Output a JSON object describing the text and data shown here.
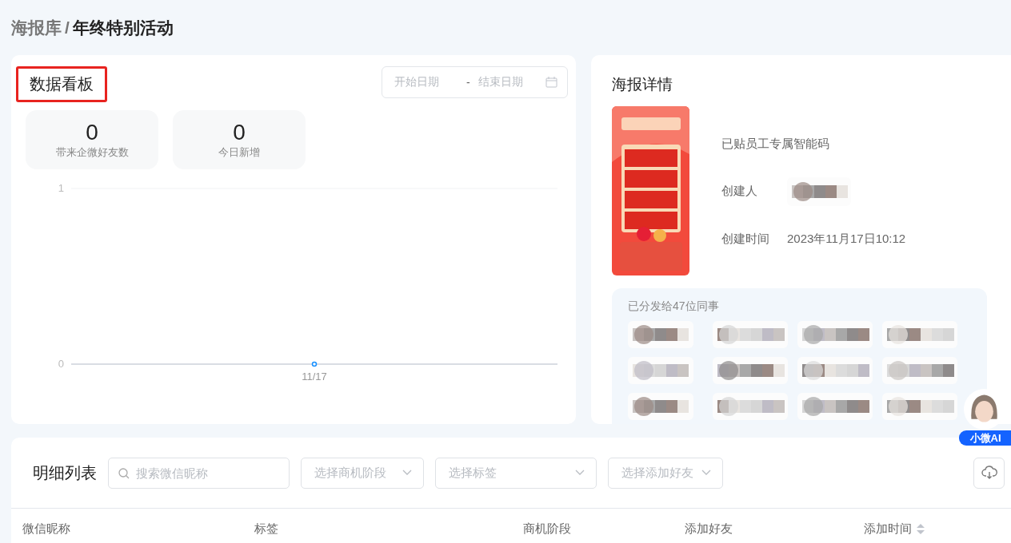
{
  "breadcrumb": {
    "parent": "海报库",
    "separator": "/",
    "current": "年终特别活动"
  },
  "dashboard": {
    "title": "数据看板",
    "highlighted": true,
    "date_range": {
      "start_placeholder": "开始日期",
      "separator": "-",
      "end_placeholder": "结束日期"
    },
    "stats": [
      {
        "value": "0",
        "label": "带来企微好友数"
      },
      {
        "value": "0",
        "label": "今日新增"
      }
    ],
    "chart_data": {
      "type": "line",
      "categories": [
        "11/17"
      ],
      "series": [
        {
          "color": "#1890ff",
          "marker": true,
          "values": [
            0
          ]
        }
      ],
      "ylim": [
        0,
        1
      ],
      "yticks": [
        0,
        1
      ]
    }
  },
  "poster_detail": {
    "title": "海报详情",
    "status": "已贴员工专属智能码",
    "fields": [
      {
        "label": "创建人",
        "kind": "picture"
      },
      {
        "label": "创建时间",
        "kind": "text",
        "value": "2023年11月17日10:12"
      }
    ],
    "distribution": {
      "title": "已分发给47位同事"
    }
  },
  "assistant": {
    "label": "小微AI"
  },
  "detail_list": {
    "title": "明细列表",
    "search": {
      "placeholder": "搜索微信昵称"
    },
    "filters": [
      {
        "placeholder": "选择商机阶段"
      },
      {
        "placeholder": "选择标签"
      },
      {
        "placeholder": "选择添加好友"
      }
    ],
    "columns": [
      {
        "label": "微信昵称",
        "sortable": false
      },
      {
        "label": "标签",
        "sortable": false
      },
      {
        "label": "商机阶段",
        "sortable": false
      },
      {
        "label": "添加好友",
        "sortable": false
      },
      {
        "label": "添加时间",
        "sortable": true
      }
    ]
  }
}
